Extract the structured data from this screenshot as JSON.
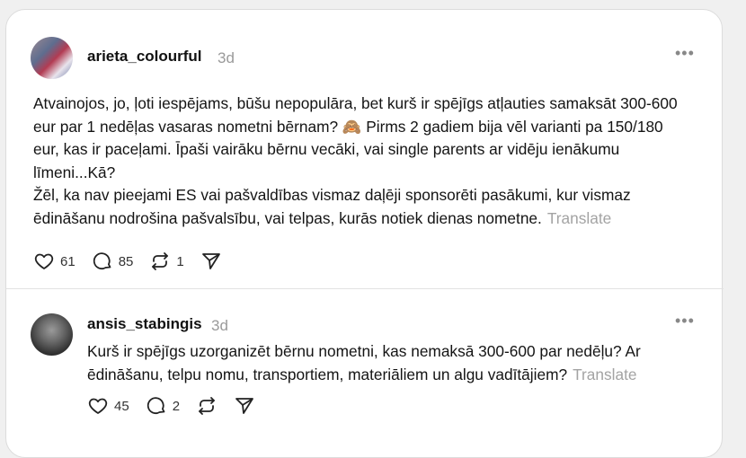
{
  "posts": [
    {
      "username": "arieta_colourful",
      "time": "3d",
      "paragraphs": [
        "Atvainojos, jo, ļoti iespējams, būšu nepopulāra, bet kurš ir spējīgs atļauties samaksāt 300-600 eur par 1 nedēļas vasaras nometni bērnam? 🙈 Pirms 2 gadiem bija vēl varianti pa 150/180 eur, kas ir paceļami. Īpaši vairāku bērnu vecāki, vai single parents ar vidēju ienākumu līmeni...Kā?",
        "Žēl, ka nav pieejami ES vai pašvaldības vismaz daļēji sponsorēti pasākumi, kur vismaz ēdināšanu nodrošina pašvalsību, vai telpas, kurās notiek dienas nometne."
      ],
      "translate": "Translate",
      "likes": "61",
      "comments": "85",
      "reposts": "1"
    },
    {
      "username": "ansis_stabingis",
      "time": "3d",
      "paragraphs": [
        "Kurš ir spējīgs uzorganizēt bērnu nometni, kas nemaksā 300-600 par nedēļu? Ar ēdināšanu, telpu nomu, transportiem, materiāliem un algu vadītājiem?"
      ],
      "translate": "Translate",
      "likes": "45",
      "comments": "2"
    }
  ],
  "icons": {
    "more": "more-horizontal-icon",
    "like": "heart-icon",
    "comment": "comment-bubble-icon",
    "repost": "repost-icon",
    "share": "send-icon"
  }
}
